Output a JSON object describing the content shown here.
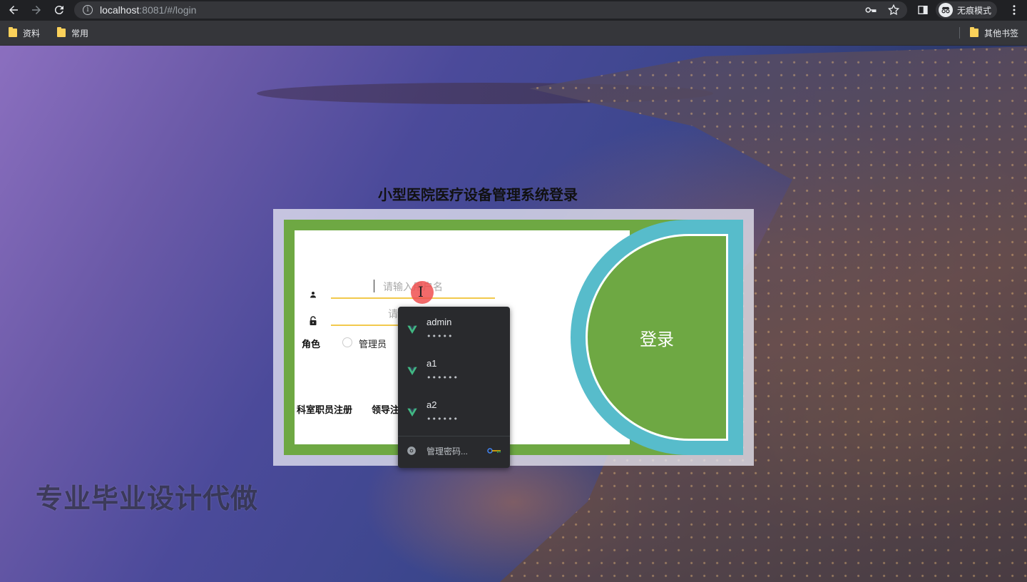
{
  "browser": {
    "url_host": "localhost",
    "url_rest": ":8081/#/login",
    "incognito_label": "无痕模式",
    "bookmarks": [
      "资料",
      "常用"
    ],
    "other_bookmarks": "其他书签"
  },
  "page": {
    "title": "小型医院医疗设备管理系统登录",
    "watermark": "专业毕业设计代做",
    "username_placeholder": "请输入用户名",
    "password_placeholder": "请输入密码",
    "role_label": "角色",
    "role_option": "管理员",
    "register_links": [
      "科室职员注册",
      "领导注"
    ],
    "login_button": "登录"
  },
  "autofill": {
    "entries": [
      {
        "user": "admin",
        "pass": "•••••"
      },
      {
        "user": "a1",
        "pass": "••••••"
      },
      {
        "user": "a2",
        "pass": "••••••"
      }
    ],
    "manage_label": "管理密码..."
  },
  "colors": {
    "panel_green": "#6ea843",
    "panel_teal": "#57bccb",
    "input_underline": "#f2c94c",
    "dropdown_bg": "#292a2d"
  }
}
